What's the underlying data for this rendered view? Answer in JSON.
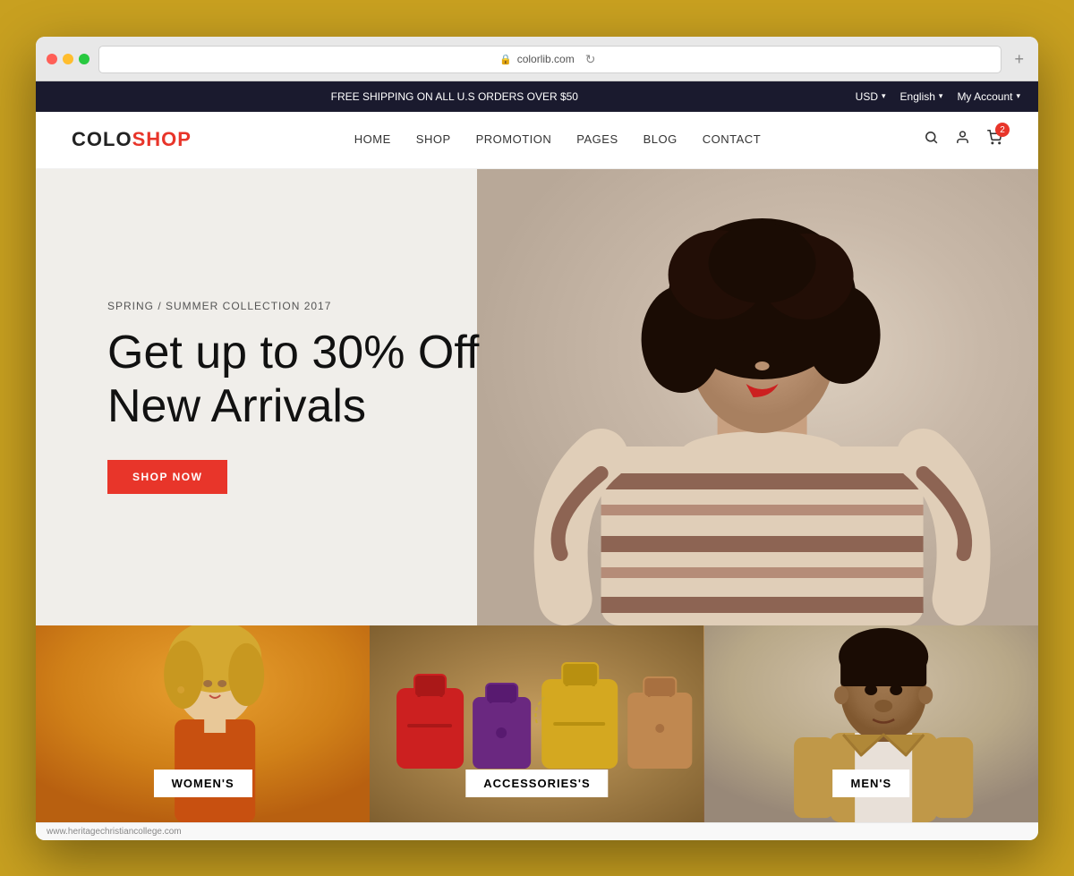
{
  "browser": {
    "url": "colorlib.com",
    "new_tab_label": "+"
  },
  "announcement": {
    "text": "FREE SHIPPING ON ALL U.S ORDERS OVER $50",
    "currency": "USD",
    "language": "English",
    "account": "My Account"
  },
  "nav": {
    "logo_colo": "COLO",
    "logo_shop": "SHOP",
    "links": [
      "HOME",
      "SHOP",
      "PROMOTION",
      "PAGES",
      "BLOG",
      "CONTACT"
    ],
    "cart_count": "2"
  },
  "hero": {
    "subtitle": "SPRING / SUMMER COLLECTION 2017",
    "title_line1": "Get up to 30% Off",
    "title_line2": "New Arrivals",
    "button_label": "SHOP NOW"
  },
  "categories": [
    {
      "label": "WOMEN'S"
    },
    {
      "label": "ACCESSORIES'S"
    },
    {
      "label": "MEN'S"
    }
  ],
  "status_bar": {
    "url": "www.heritagechristiancollege.com"
  }
}
